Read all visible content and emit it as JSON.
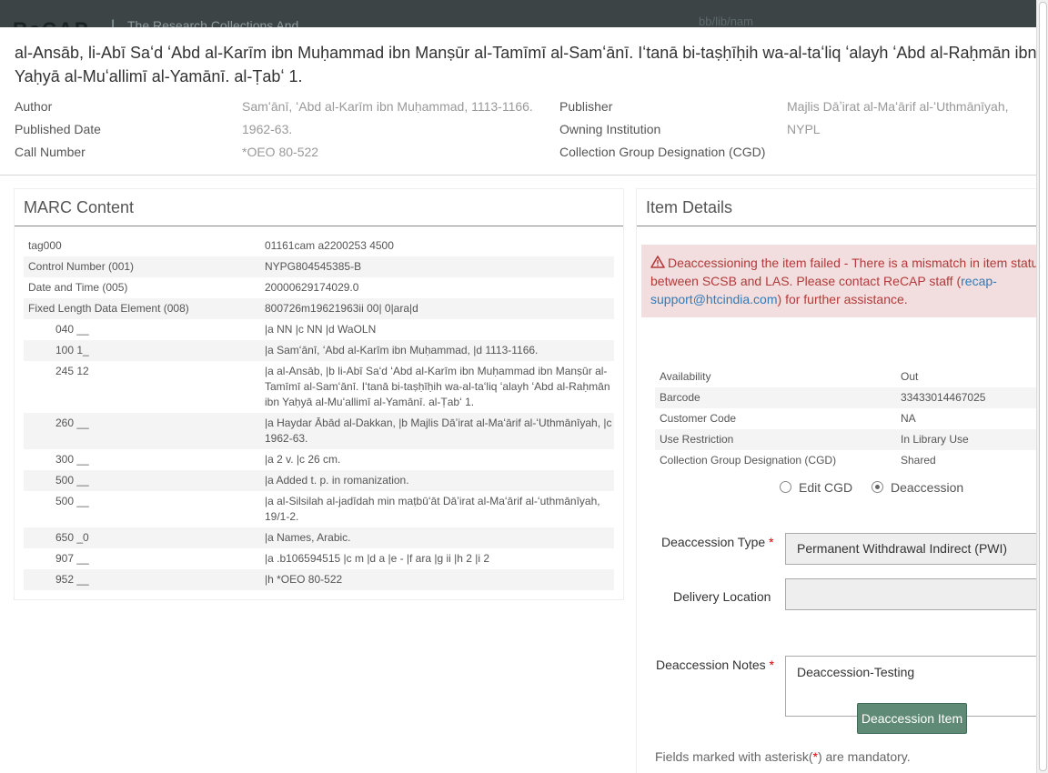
{
  "background": {
    "logo": "ReCAP",
    "separator": "|",
    "tagline": "The Research Collections And",
    "right_text": "bb/lib/nam"
  },
  "title": "al-Ansāb, li-Abī Saʻd ʻAbd al-Karīm ibn Muḥammad ibn Manṣūr al-Tamīmī al-Samʻānī. Iʻtanā bi-taṣḥīḥih wa-al-taʻliq ʻalayh ʻAbd al-Raḥmān ibn Yaḥyā al-Muʻallimī al-Yamānī. al-Ṭabʻ 1.",
  "meta": {
    "author_label": "Author",
    "author_value": "Samʻānī, ʻAbd al-Karīm ibn Muḥammad, 1113-1166.",
    "published_label": "Published Date",
    "published_value": "1962-63.",
    "call_label": "Call Number",
    "call_value": "*OEO 80-522",
    "publisher_label": "Publisher",
    "publisher_value": "Majlis Dāʼirat al-Maʻārif al-ʻUthmānīyah,",
    "owning_label": "Owning Institution",
    "owning_value": "NYPL",
    "cgd_label": "Collection Group Designation (CGD)",
    "cgd_value": ""
  },
  "marc": {
    "title": "MARC Content",
    "rows": [
      {
        "tag": "tag000",
        "value": "01161cam a2200253 4500"
      },
      {
        "tag": "Control Number (001)",
        "value": "NYPG804545385-B"
      },
      {
        "tag": "Date and Time (005)",
        "value": "20000629174029.0"
      },
      {
        "tag": "Fixed Length Data Element (008)",
        "value": "800726m19621963ii 00| 0|ara|d"
      },
      {
        "tag": "040 __",
        "value": "|a NN |c NN |d WaOLN"
      },
      {
        "tag": "100 1_",
        "value": "|a Samʻānī, ʻAbd al-Karīm ibn Muḥammad, |d 1113-1166."
      },
      {
        "tag": "245 12",
        "value": "|a al-Ansāb, |b li-Abī Saʻd ʻAbd al-Karīm ibn Muḥammad ibn Manṣūr al-Tamīmī al-Samʻānī. Iʻtanā bi-taṣḥīḥih wa-al-taʻliq ʻalayh ʻAbd al-Raḥmān ibn Yaḥyā al-Muʻallimī al-Yamānī. al-Ṭabʻ 1."
      },
      {
        "tag": "260 __",
        "value": "|a Haydar Ābād al-Dakkan, |b Majlis Dāʼirat al-Maʻārif al-ʻUthmānīyah, |c 1962-63."
      },
      {
        "tag": "300 __",
        "value": "|a 2 v. |c 26 cm."
      },
      {
        "tag": "500 __",
        "value": "|a Added t. p. in romanization."
      },
      {
        "tag": "500 __",
        "value": "|a al-Silsilah al-jadīdah min maṭbūʻāt Dāʼirat al-Maʻārif al-ʻuthmānīyah, 19/1-2."
      },
      {
        "tag": "650 _0",
        "value": "|a Names, Arabic."
      },
      {
        "tag": "907 __",
        "value": "|a .b106594515 |c m |d a |e - |f ara |g ii |h 2 |i 2"
      },
      {
        "tag": "952 __",
        "value": "|h *OEO 80-522"
      }
    ]
  },
  "details": {
    "title": "Item Details",
    "alert_prefix": "Deaccessioning the item failed - There is a mismatch in item status between SCSB and LAS. Please contact ReCAP staff (",
    "alert_email": "recap-support@htcindia.com",
    "alert_suffix": ") for further assistance.",
    "rows": [
      {
        "label": "Availability",
        "value": "Out"
      },
      {
        "label": "Barcode",
        "value": "33433014467025"
      },
      {
        "label": "Customer Code",
        "value": "NA"
      },
      {
        "label": "Use Restriction",
        "value": "In Library Use"
      },
      {
        "label": "Collection Group Designation (CGD)",
        "value": "Shared"
      }
    ],
    "radio_edit_cgd": "Edit CGD",
    "radio_deaccession": "Deaccession",
    "selected_radio": "Deaccession",
    "deaccession_type_label": "Deaccession Type",
    "deaccession_type_value": "Permanent Withdrawal Indirect (PWI)",
    "delivery_location_label": "Delivery Location",
    "delivery_location_value": "",
    "notes_label": "Deaccession Notes",
    "notes_value": "Deaccession-Testing",
    "button_label": "Deaccession Item",
    "footnote_prefix": "Fields marked with asterisk(",
    "footnote_star": "*",
    "footnote_suffix": ") are mandatory.",
    "required_mark": "*"
  },
  "colors": {
    "alert_bg": "#f2dede",
    "alert_text": "#b33a3a",
    "button_bg": "#5f8a75",
    "required": "#dd0000"
  }
}
